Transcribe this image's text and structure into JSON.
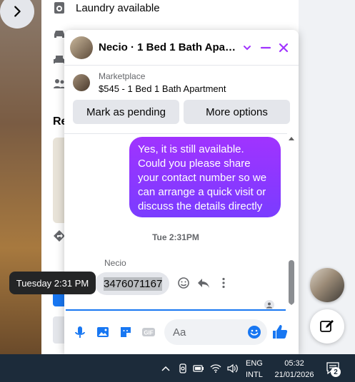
{
  "background_page": {
    "features": [
      {
        "icon": "washer-icon",
        "label": "Laundry available"
      }
    ],
    "section_label": "Re"
  },
  "chat": {
    "title": "Necio · 1 Bed 1 Bath Apart…",
    "listing": {
      "source": "Marketplace",
      "title": "$545 - 1 Bed 1 Bath Apartment"
    },
    "actions": {
      "mark_pending": "Mark as pending",
      "more_options": "More options"
    },
    "messages": {
      "outgoing_text": "Yes, it is still available. Could you please share your contact number so we can arrange a quick visit or discuss the details directly",
      "time_separator": "Tue 2:31PM",
      "sender_name": "Necio",
      "incoming_text": "3476071167"
    },
    "composer": {
      "placeholder": "Aa"
    },
    "colors": {
      "outgoing_bubble_top": "#a033ff",
      "outgoing_bubble_bottom": "#7a3cff",
      "accent": "#1877f2",
      "header_icon": "#a033ff"
    }
  },
  "tooltip": {
    "text": "Tuesday 2:31 PM"
  },
  "taskbar": {
    "lang_top": "ENG",
    "lang_bottom": "INTL",
    "time": "05:32",
    "date": "21/01/2026",
    "notification_count": "2"
  }
}
